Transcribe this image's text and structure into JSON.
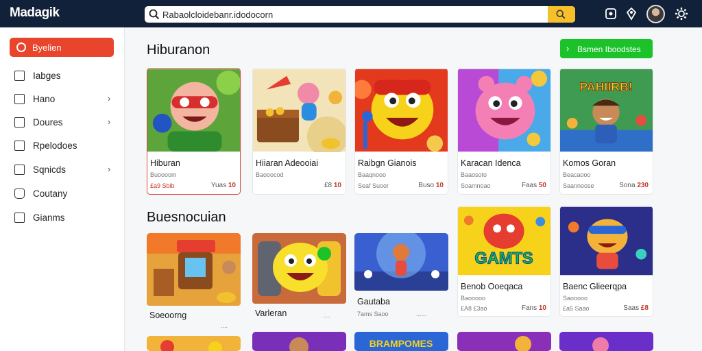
{
  "header": {
    "logo": "Madagik",
    "search_value": "Rabaolcloidebanr.idodocorn"
  },
  "sidebar": {
    "active": "Byelien",
    "items": [
      {
        "label": "Iabges",
        "chevron": false
      },
      {
        "label": "Hano",
        "chevron": true
      },
      {
        "label": "Doures",
        "chevron": true
      },
      {
        "label": "Rpelodoes",
        "chevron": false
      },
      {
        "label": "Sqnicds",
        "chevron": true
      },
      {
        "label": "Coutany",
        "chevron": false
      },
      {
        "label": "Gianms",
        "chevron": false
      }
    ]
  },
  "sections": {
    "first_title": "Hiburanon",
    "second_title": "Buesnocuian",
    "cta_label": "Bsmen Iboodstes"
  },
  "cards_row1": [
    {
      "title": "Hiburan",
      "sub": "Buoooom",
      "meta": "£a9 Sbib",
      "price_prefix": "Yuas",
      "price": "10"
    },
    {
      "title": "Hiiaran Adeooiai",
      "sub": "Baooocod",
      "meta": "",
      "price_prefix": "£8",
      "price": "10"
    },
    {
      "title": "Raibgn Gianois",
      "sub": "Baaqnooo",
      "meta": "Seaf Suoor",
      "price_prefix": "Buso",
      "price": "10"
    },
    {
      "title": "Karacan Idenca",
      "sub": "Baaosoto",
      "meta": "Soamnoao",
      "price_prefix": "Faas",
      "price": "50"
    },
    {
      "title": "Komos Goran",
      "sub": "Beacaooo",
      "meta": "Saannoose",
      "price_prefix": "Sona",
      "price": "230"
    }
  ],
  "cards_row2": [
    {
      "title": "Soeoorng",
      "sub": "",
      "meta": "",
      "price_prefix": "....",
      "price": ""
    },
    {
      "title": "Varleran",
      "sub": "",
      "meta": "",
      "price_prefix": "....",
      "price": ""
    },
    {
      "title": "Gautaba",
      "sub": "",
      "meta": "7ams Saoo",
      "price_prefix": "......",
      "price": ""
    }
  ],
  "cards_right": [
    {
      "thumb_text": "GAMTS",
      "title": "Benob Ooeqaca",
      "sub": "Baooooo",
      "meta": "£A8 £3ao",
      "price_prefix": "Fans",
      "price": "10"
    },
    {
      "thumb_text": "",
      "title": "Baenc Glieerqpa",
      "sub": "Saooooo",
      "meta": "£a5 Saao",
      "price_prefix": "Saas",
      "price": "£8"
    }
  ],
  "thumb_badges": {
    "pahiirb": "PAHIIRB!",
    "bottom_row": "BRAMPOMES"
  },
  "colors": {
    "topbar": "#12213a",
    "accent_red": "#e8452c",
    "cta_green": "#1bc22a",
    "search_button": "#f5c02a"
  }
}
